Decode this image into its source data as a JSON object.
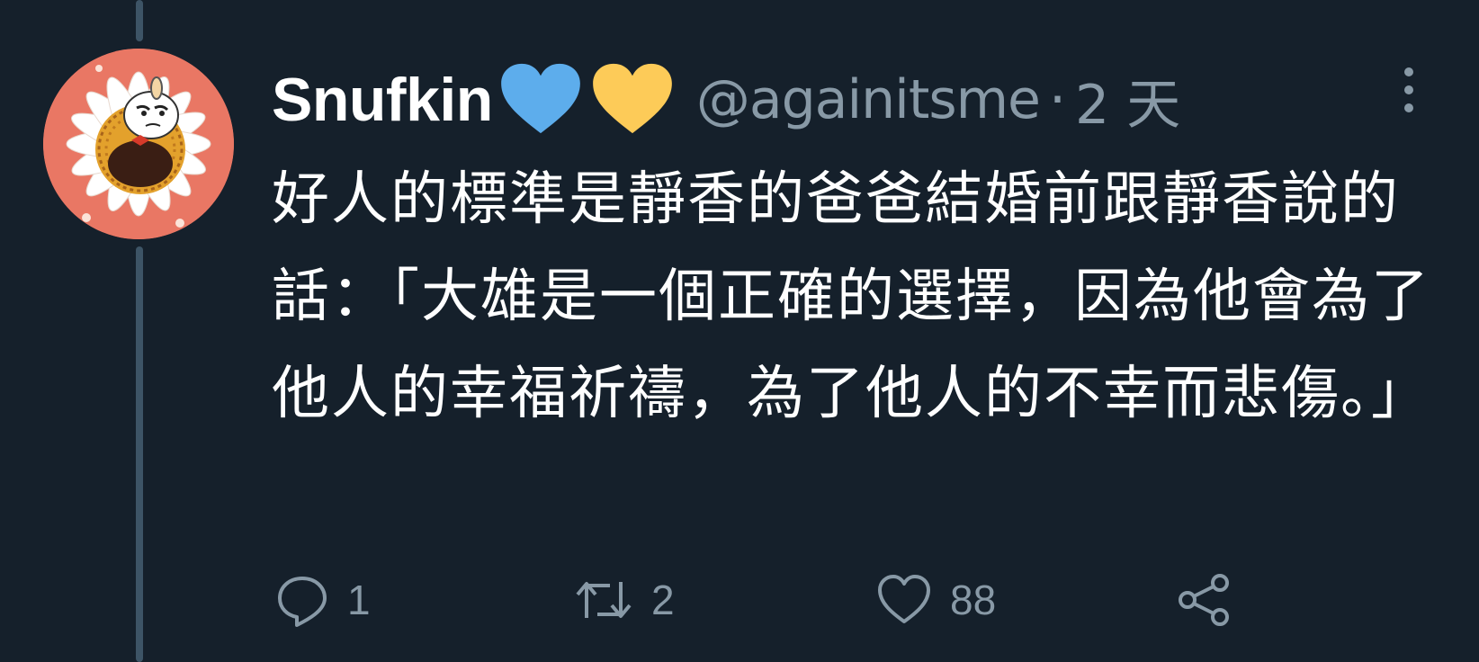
{
  "tweet": {
    "display_name": "Snufkin",
    "name_emojis": [
      "blue-heart",
      "yellow-heart"
    ],
    "handle": "@againitsme",
    "separator": "·",
    "timestamp": "2 天",
    "text": "好人的標準是靜香的爸爸結婚前跟靜香說的話：「大雄是一個正確的選擇，因為他會為了他人的幸福祈禱，為了他人的不幸而悲傷。」"
  },
  "actions": {
    "reply_count": "1",
    "retweet_count": "2",
    "like_count": "88"
  },
  "icons": {
    "reply": "speech-bubble-icon",
    "retweet": "retweet-icon",
    "like": "heart-icon",
    "share": "share-icon",
    "more": "vertical-ellipsis-icon"
  },
  "colors": {
    "background": "#15202b",
    "secondary_text": "#8899a6",
    "avatar_background": "#e97764",
    "blue_heart": "#5dadec",
    "yellow_heart": "#fdcb58"
  }
}
